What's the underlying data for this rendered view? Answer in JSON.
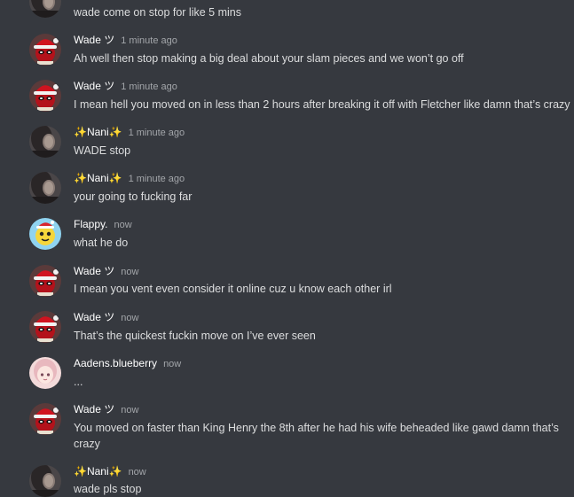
{
  "messages": [
    {
      "author": "",
      "time": "",
      "text": "wade come on stop for like 5 mins",
      "avatar": "dark-avatar-icon"
    },
    {
      "author": "Wade ツ",
      "time": "1 minute ago",
      "text": "Ah well then stop making a big deal about your slam pieces and we won’t go off",
      "avatar": "deadpool-santa-avatar-icon"
    },
    {
      "author": "Wade ツ",
      "time": "1 minute ago",
      "text": "I mean hell you moved on in less than 2 hours after breaking it off with Fletcher like damn that’s crazy",
      "avatar": "deadpool-santa-avatar-icon"
    },
    {
      "author": "✨Nani✨",
      "time": "1 minute ago",
      "text": "WADE stop",
      "avatar": "dark-avatar-icon"
    },
    {
      "author": "✨Nani✨",
      "time": "1 minute ago",
      "text": "your going to fucking far",
      "avatar": "dark-avatar-icon"
    },
    {
      "author": "Flappy.",
      "time": "now",
      "text": "what he do",
      "avatar": "yellow-creature-avatar-icon"
    },
    {
      "author": "Wade ツ",
      "time": "now",
      "text": "I mean you vent even consider it online cuz u know each other irl",
      "avatar": "deadpool-santa-avatar-icon"
    },
    {
      "author": "Wade ツ",
      "time": "now",
      "text": "That’s the quickest fuckin move on I’ve ever seen",
      "avatar": "deadpool-santa-avatar-icon"
    },
    {
      "author": "Aadens.blueberry",
      "time": "now",
      "text": "...",
      "avatar": "pink-anime-avatar-icon"
    },
    {
      "author": "Wade ツ",
      "time": "now",
      "text": "You moved on faster than King Henry the 8th after he had his wife beheaded like gawd damn that’s crazy",
      "avatar": "deadpool-santa-avatar-icon"
    },
    {
      "author": "✨Nani✨",
      "time": "now",
      "text": "wade pls stop",
      "avatar": "dark-avatar-icon"
    }
  ],
  "colors": {
    "background": "#36393f",
    "author": "#ffffff",
    "timestamp": "#a3a6aa",
    "text": "#dcddde"
  }
}
